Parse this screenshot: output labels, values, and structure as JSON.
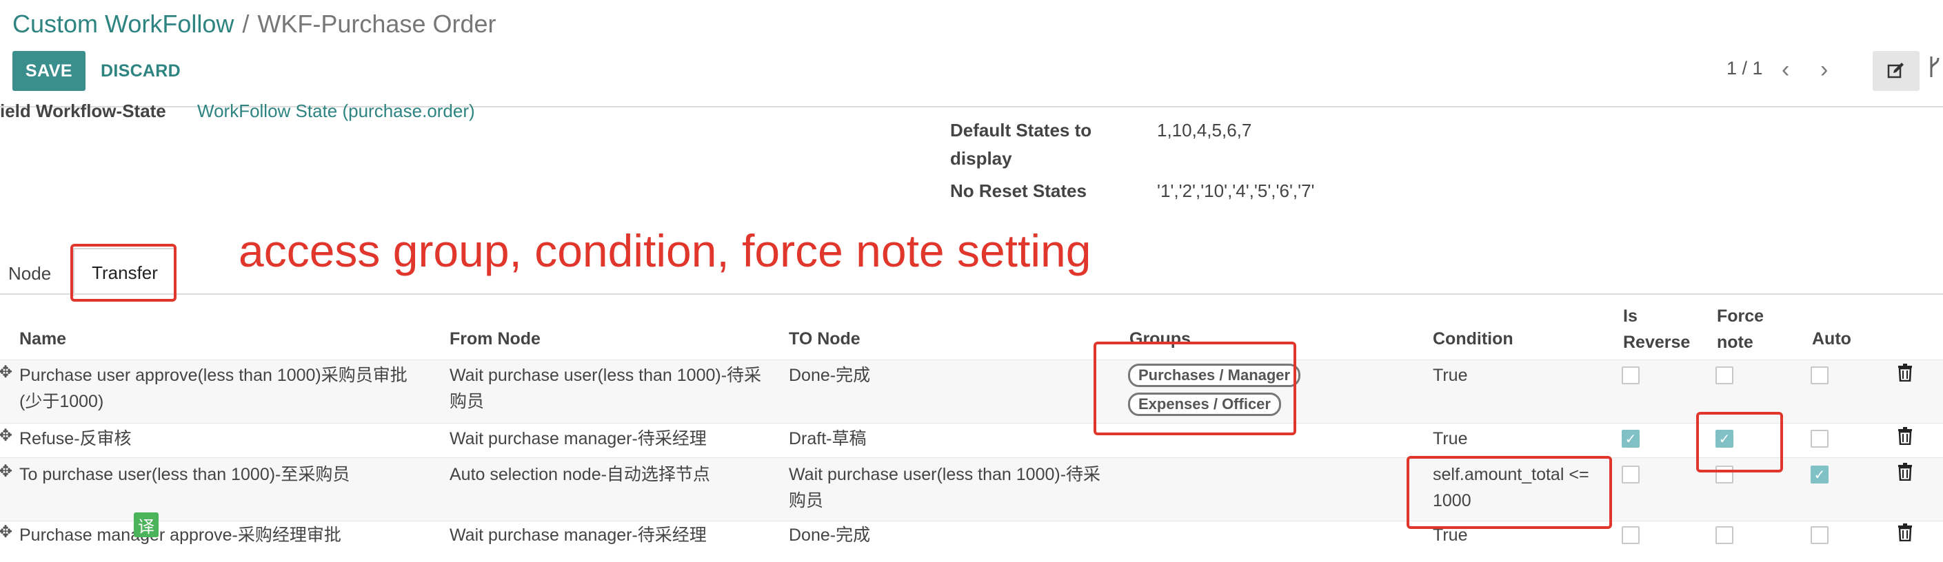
{
  "breadcrumb": {
    "parent": "Custom WorkFollow",
    "separator": "/",
    "current": "WKF-Purchase Order"
  },
  "toolbar": {
    "save_label": "SAVE",
    "discard_label": "DISCARD"
  },
  "pager": {
    "value": "1 / 1",
    "prev_icon": "chevron-left-icon",
    "next_icon": "chevron-right-icon"
  },
  "form": {
    "field_workflow_state_label": "ield Workflow-State",
    "field_workflow_state_value": "WorkFollow State (purchase.order)",
    "default_states_label_line1": "Default States to",
    "default_states_label_line2": "display",
    "default_states_value": "1,10,4,5,6,7",
    "no_reset_states_label": "No Reset States",
    "no_reset_states_value": "'1','2','10','4','5','6','7'"
  },
  "tabs": [
    {
      "label": "Node"
    },
    {
      "label": "Transfer"
    }
  ],
  "annotation": "access group, condition, force note setting",
  "table": {
    "headers": {
      "name": "Name",
      "from": "From Node",
      "to": "TO Node",
      "groups": "Groups",
      "condition": "Condition",
      "is_reverse_line1": "Is",
      "is_reverse_line2": "Reverse",
      "force_note_line1": "Force",
      "force_note_line2": "note",
      "auto": "Auto"
    },
    "rows": [
      {
        "name_line1": "Purchase user approve(less than 1000)采购员审批",
        "name_line2": "(少于1000)",
        "from_line1": "Wait purchase user(less than 1000)-待采",
        "from_line2": "购员",
        "to_line1": "Done-完成",
        "to_line2": "",
        "groups": [
          "Purchases / Manager",
          "Expenses / Officer"
        ],
        "condition_line1": "True",
        "condition_line2": "",
        "is_reverse": false,
        "force_note": false,
        "auto": false
      },
      {
        "name_line1": "Refuse-反审核",
        "name_line2": "",
        "from_line1": "Wait purchase manager-待采经理",
        "from_line2": "",
        "to_line1": "Draft-草稿",
        "to_line2": "",
        "groups": [],
        "condition_line1": "True",
        "condition_line2": "",
        "is_reverse": true,
        "force_note": true,
        "auto": false
      },
      {
        "name_line1": "To purchase user(less than 1000)-至采购员",
        "name_line2": "",
        "from_line1": "Auto selection node-自动选择节点",
        "from_line2": "",
        "to_line1": "Wait purchase user(less than 1000)-待采",
        "to_line2": "购员",
        "groups": [],
        "condition_line1": "self.amount_total <=",
        "condition_line2": "1000",
        "is_reverse": false,
        "force_note": false,
        "auto": true
      },
      {
        "name_line1": "Purchase manager approve-采购经理审批",
        "name_line2": "",
        "from_line1": "Wait purchase manager-待采经理",
        "from_line2": "",
        "to_line1": "Done-完成",
        "to_line2": "",
        "groups": [],
        "condition_line1": "True",
        "condition_line2": "",
        "is_reverse": false,
        "force_note": false,
        "auto": false
      }
    ]
  },
  "translate_badge": "译",
  "colors": {
    "accent": "#3a8f8d",
    "link": "#2e8481",
    "annotation_red": "#e0362c",
    "checkbox_on": "#7fc1c5"
  }
}
